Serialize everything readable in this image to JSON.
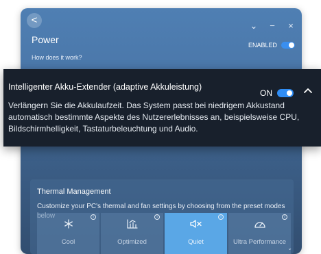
{
  "header": {
    "title": "Power",
    "help_link": "How does it work?",
    "enabled_label": "ENABLED",
    "enabled": true,
    "back_glyph": "<",
    "controls": [
      "⌄",
      "−",
      "×"
    ]
  },
  "tooltip": {
    "title": "Intelligenter Akku-Extender (adaptive Akkuleistung)",
    "state_label": "ON",
    "enabled": true,
    "description": "Verlängern Sie die Akkulaufzeit. Das System passt bei niedrigem Akkustand automatisch bestimmte Aspekte des Nutzererlebnisses an, beispielsweise CPU, Bildschirmhelligkeit, Tastaturbeleuchtung und Audio."
  },
  "thermal": {
    "title": "Thermal Management",
    "description": "Customize your PC's thermal and fan settings by choosing from the preset modes below",
    "modes": [
      {
        "label": "Cool",
        "icon": "snowflake-icon",
        "selected": false
      },
      {
        "label": "Optimized",
        "icon": "chart-icon",
        "selected": false
      },
      {
        "label": "Quiet",
        "icon": "speaker-mute-icon",
        "selected": true
      },
      {
        "label": "Ultra Performance",
        "icon": "gauge-icon",
        "selected": false
      }
    ],
    "info_glyph": "i"
  },
  "colors": {
    "accent": "#2f8df5",
    "selected_mode": "#5aa7e6",
    "overlay_bg": "#18202c"
  }
}
